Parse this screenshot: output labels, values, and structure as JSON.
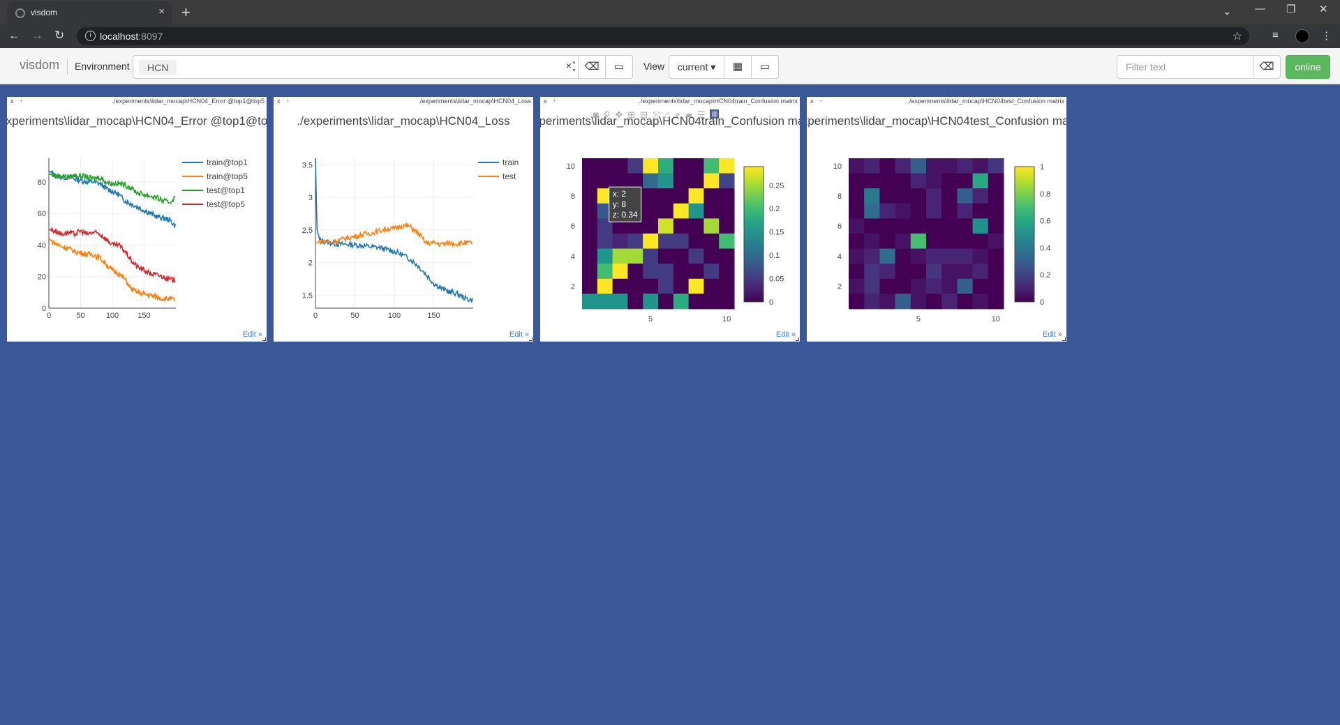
{
  "browser": {
    "tab_title": "visdom",
    "url_host": "localhost",
    "url_port": ":8097",
    "tab_close": "×",
    "new_tab": "+"
  },
  "visdom_nav": {
    "brand": "visdom",
    "environment_label": "Environment",
    "environment_value": "HCN",
    "view_label": "View",
    "view_value": "current ▾",
    "filter_placeholder": "Filter text",
    "status": "online"
  },
  "panes": [
    {
      "id": "error",
      "header": "./experiments\\lidar_mocap\\HCN04_Error @top1@top5",
      "title": "./experiments\\lidar_mocap\\HCN04_Error @top1@top5",
      "edit": "Edit »"
    },
    {
      "id": "loss",
      "header": "./experiments\\lidar_mocap\\HCN04_Loss",
      "title": "./experiments\\lidar_mocap\\HCN04_Loss",
      "edit": "Edit »"
    },
    {
      "id": "train-cm",
      "header": "./experiments\\lidar_mocap\\HCN04train_Confusion matrix",
      "title": "./experiments\\lidar_mocap\\HCN04train_Confusion matrix",
      "edit": "Edit »"
    },
    {
      "id": "test-cm",
      "header": "./experiments\\lidar_mocap\\HCN04test_Confusion matrix",
      "title": "./experiments\\lidar_mocap\\HCN04test_Confusion matrix",
      "edit": "Edit »"
    }
  ],
  "hover_tooltip": {
    "x": "x: 2",
    "y": "y: 8",
    "z": "z: 0.34"
  },
  "chart_data": [
    {
      "type": "line",
      "title": "./experiments\\lidar_mocap\\HCN04_Error @top1@top5",
      "xlim": [
        0,
        200
      ],
      "ylim": [
        0,
        95
      ],
      "xticks": [
        0,
        50,
        100,
        150
      ],
      "yticks": [
        0,
        20,
        40,
        60,
        80
      ],
      "x": [
        0,
        10,
        20,
        30,
        40,
        50,
        60,
        70,
        80,
        90,
        100,
        110,
        120,
        130,
        140,
        150,
        160,
        170,
        180,
        190,
        199
      ],
      "series": [
        {
          "name": "train@top1",
          "color": "#1f77b4",
          "values": [
            87,
            84,
            83,
            83,
            82,
            81,
            80,
            80,
            79,
            76,
            74,
            72,
            68,
            66,
            64,
            62,
            60,
            58,
            57,
            56,
            52
          ]
        },
        {
          "name": "train@top5",
          "color": "#ff7f0e",
          "values": [
            44,
            41,
            39,
            38,
            36,
            35,
            34,
            34,
            32,
            28,
            24,
            22,
            18,
            12,
            10,
            9,
            8,
            7,
            6,
            6,
            5
          ]
        },
        {
          "name": "test@top1",
          "color": "#2ca02c",
          "values": [
            85,
            84,
            84,
            83,
            84,
            84,
            83,
            82,
            83,
            80,
            79,
            79,
            78,
            76,
            73,
            72,
            71,
            70,
            68,
            67,
            70
          ]
        },
        {
          "name": "test@top5",
          "color": "#d62728",
          "values": [
            50,
            49,
            47,
            48,
            47,
            49,
            47,
            48,
            47,
            44,
            40,
            40,
            36,
            30,
            26,
            24,
            22,
            21,
            20,
            18,
            18
          ]
        }
      ],
      "legend": "top-right",
      "grid": true
    },
    {
      "type": "line",
      "title": "./experiments\\lidar_mocap\\HCN04_Loss",
      "xlim": [
        0,
        200
      ],
      "ylim": [
        1.3,
        3.6
      ],
      "xticks": [
        0,
        50,
        100,
        150
      ],
      "yticks": [
        1.5,
        2,
        2.5,
        3,
        3.5
      ],
      "x": [
        0,
        2,
        5,
        10,
        20,
        30,
        40,
        50,
        60,
        70,
        80,
        90,
        100,
        110,
        120,
        130,
        140,
        150,
        160,
        170,
        180,
        190,
        199
      ],
      "series": [
        {
          "name": "train",
          "color": "#1f77b4",
          "values": [
            3.6,
            2.5,
            2.35,
            2.33,
            2.3,
            2.28,
            2.28,
            2.27,
            2.26,
            2.24,
            2.23,
            2.2,
            2.17,
            2.12,
            2.05,
            1.95,
            1.82,
            1.68,
            1.6,
            1.55,
            1.52,
            1.45,
            1.42
          ]
        },
        {
          "name": "test",
          "color": "#ff7f0e",
          "values": [
            2.3,
            2.3,
            2.32,
            2.33,
            2.31,
            2.34,
            2.38,
            2.4,
            2.43,
            2.45,
            2.48,
            2.52,
            2.52,
            2.57,
            2.55,
            2.45,
            2.3,
            2.3,
            2.28,
            2.3,
            2.29,
            2.3,
            2.3
          ]
        }
      ],
      "legend": "top-right",
      "grid": true
    },
    {
      "type": "heatmap",
      "title": "./experiments\\lidar_mocap\\HCN04train_Confusion matrix",
      "xlim": [
        0.5,
        10.5
      ],
      "ylim": [
        0.5,
        10.5
      ],
      "xticks": [
        5,
        10
      ],
      "yticks": [
        2,
        4,
        6,
        8,
        10
      ],
      "zlim": [
        0,
        0.29
      ],
      "colorbar_ticks": [
        0,
        0.05,
        0.1,
        0.15,
        0.2,
        0.25
      ],
      "matrix_rows_top_down": [
        [
          0.0,
          0.0,
          0.0,
          0.05,
          0.29,
          0.18,
          0.0,
          0.0,
          0.2,
          0.29
        ],
        [
          0.0,
          0.0,
          0.0,
          0.0,
          0.1,
          0.15,
          0.0,
          0.0,
          0.29,
          0.06
        ],
        [
          0.0,
          0.29,
          0.0,
          0.0,
          0.0,
          0.0,
          0.0,
          0.29,
          0.0,
          0.0
        ],
        [
          0.0,
          0.08,
          0.34,
          0.0,
          0.0,
          0.0,
          0.29,
          0.15,
          0.0,
          0.0
        ],
        [
          0.0,
          0.05,
          0.0,
          0.0,
          0.0,
          0.27,
          0.0,
          0.0,
          0.25,
          0.0
        ],
        [
          0.0,
          0.05,
          0.03,
          0.05,
          0.29,
          0.05,
          0.05,
          0.0,
          0.0,
          0.2
        ],
        [
          0.0,
          0.15,
          0.25,
          0.25,
          0.05,
          0.0,
          0.0,
          0.05,
          0.0,
          0.0
        ],
        [
          0.0,
          0.2,
          0.29,
          0.0,
          0.05,
          0.05,
          0.0,
          0.0,
          0.05,
          0.0
        ],
        [
          0.0,
          0.29,
          0.0,
          0.0,
          0.0,
          0.05,
          0.0,
          0.29,
          0.0,
          0.0
        ],
        [
          0.15,
          0.15,
          0.15,
          0.0,
          0.15,
          0.0,
          0.18,
          0.0,
          0.0,
          0.0
        ]
      ]
    },
    {
      "type": "heatmap",
      "title": "./experiments\\lidar_mocap\\HCN04test_Confusion matrix",
      "xlim": [
        0.5,
        10.5
      ],
      "ylim": [
        0.5,
        10.5
      ],
      "xticks": [
        5,
        10
      ],
      "yticks": [
        2,
        4,
        6,
        8,
        10
      ],
      "zlim": [
        0,
        1
      ],
      "colorbar_ticks": [
        0,
        0.2,
        0.4,
        0.6,
        0.8,
        1
      ],
      "matrix_rows_top_down": [
        [
          0.05,
          0.1,
          0.0,
          0.1,
          0.3,
          0.05,
          0.05,
          0.1,
          0.05,
          0.15
        ],
        [
          0.0,
          0.0,
          0.0,
          0.0,
          0.1,
          0.05,
          0.0,
          0.0,
          0.6,
          0.0
        ],
        [
          0.0,
          0.4,
          0.0,
          0.0,
          0.0,
          0.1,
          0.0,
          0.3,
          0.1,
          0.0
        ],
        [
          0.0,
          0.35,
          0.1,
          0.05,
          0.0,
          0.1,
          0.0,
          0.1,
          0.0,
          0.0
        ],
        [
          0.05,
          0.0,
          0.0,
          0.0,
          0.0,
          0.0,
          0.0,
          0.0,
          0.5,
          0.0
        ],
        [
          0.0,
          0.05,
          0.0,
          0.05,
          0.7,
          0.0,
          0.0,
          0.0,
          0.0,
          0.05
        ],
        [
          0.05,
          0.1,
          0.35,
          0.0,
          0.05,
          0.1,
          0.1,
          0.1,
          0.05,
          0.0
        ],
        [
          0.0,
          0.15,
          0.1,
          0.0,
          0.0,
          0.15,
          0.05,
          0.05,
          0.1,
          0.0
        ],
        [
          0.05,
          0.15,
          0.0,
          0.0,
          0.05,
          0.1,
          0.05,
          0.3,
          0.0,
          0.0
        ],
        [
          0.0,
          0.1,
          0.05,
          0.3,
          0.05,
          0.0,
          0.1,
          0.0,
          0.05,
          0.0
        ]
      ]
    }
  ]
}
